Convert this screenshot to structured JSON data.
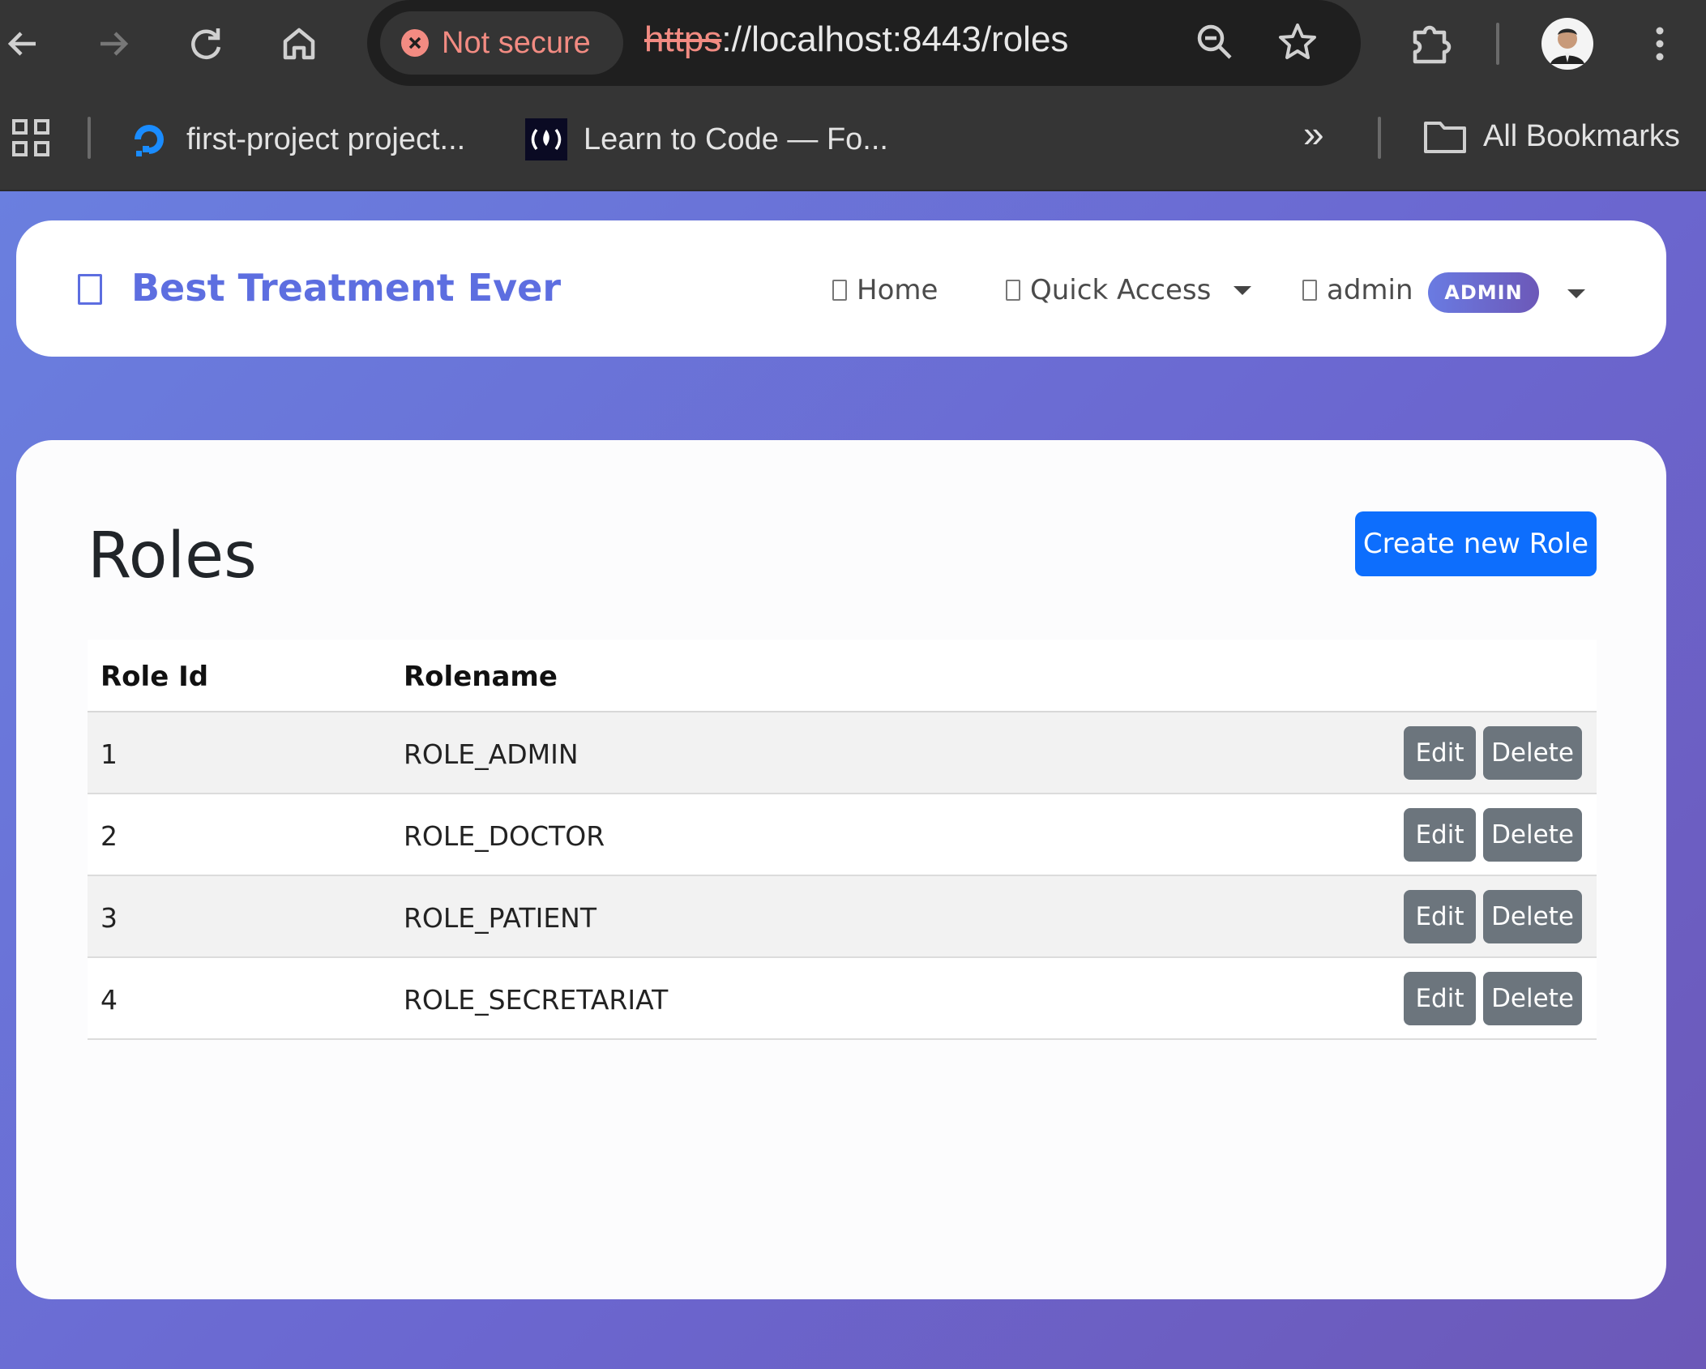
{
  "browser": {
    "security_label": "Not secure",
    "url_scheme": "https",
    "url_rest": "://localhost:8443/roles",
    "bookmarks": [
      {
        "label": "first-project project..."
      },
      {
        "label": "Learn to Code — Fo..."
      }
    ],
    "more_bookmarks": "»",
    "all_bookmarks_label": "All Bookmarks"
  },
  "navbar": {
    "brand": "Best Treatment Ever",
    "home_label": "Home",
    "quick_access_label": "Quick Access",
    "user_label": "admin",
    "role_badge": "ADMIN"
  },
  "main": {
    "title": "Roles",
    "create_button": "Create new Role",
    "columns": [
      "Role Id",
      "Rolename"
    ],
    "rows": [
      {
        "id": "1",
        "name": "ROLE_ADMIN"
      },
      {
        "id": "2",
        "name": "ROLE_DOCTOR"
      },
      {
        "id": "3",
        "name": "ROLE_PATIENT"
      },
      {
        "id": "4",
        "name": "ROLE_SECRETARIAT"
      }
    ],
    "edit_label": "Edit",
    "delete_label": "Delete"
  },
  "colors": {
    "brand": "#5d6ee0",
    "primary_button": "#0d6efd",
    "secondary_button": "#6c757d",
    "insecure": "#f28b82"
  }
}
